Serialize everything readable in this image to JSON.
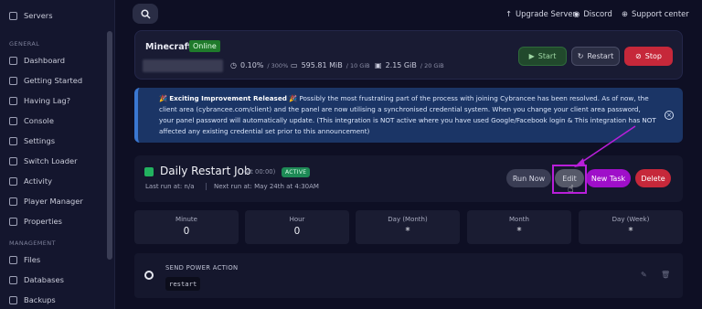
{
  "sidebar": {
    "top_item": "Servers",
    "section_general": "GENERAL",
    "section_management": "MANAGEMENT",
    "items": [
      {
        "label": "Dashboard",
        "icon": "dashboard-icon"
      },
      {
        "label": "Getting Started",
        "icon": "bulb-icon"
      },
      {
        "label": "Having Lag?",
        "icon": "bolt-icon"
      },
      {
        "label": "Console",
        "icon": "terminal-icon"
      },
      {
        "label": "Settings",
        "icon": "gear-icon"
      },
      {
        "label": "Switch Loader",
        "icon": "switch-icon"
      },
      {
        "label": "Activity",
        "icon": "activity-icon"
      },
      {
        "label": "Player Manager",
        "icon": "user-icon"
      },
      {
        "label": "Properties",
        "icon": "file-icon"
      },
      {
        "label": "Files",
        "icon": "folder-icon"
      },
      {
        "label": "Databases",
        "icon": "database-icon"
      },
      {
        "label": "Backups",
        "icon": "archive-icon"
      }
    ]
  },
  "topbar": {
    "upgrade": "Upgrade Server",
    "discord": "Discord",
    "support": "Support center"
  },
  "server": {
    "name": "Minecraft",
    "status": "Online",
    "cpu": "0.10%",
    "cpu_max": "/ 300%",
    "memory": "595.81 MiB",
    "memory_max": "/ 10 GiB",
    "disk": "2.15 GiB",
    "disk_max": "/ 20 GiB",
    "start": "Start",
    "restart": "Restart",
    "stop": "Stop"
  },
  "alert": {
    "title": "Exciting Improvement Released",
    "body": "Possibly the most frustrating part of the process with joining Cybrancee has been resolved. As of now, the client area (cybrancee.com/client) and the panel are now utilising a synchronised credential system. When you change your client area password, your panel password will automatically update. (This integration is NOT active where you have used Google/Facebook login & This integration has NOT affected any existing credential set prior to this announcement)"
  },
  "schedule": {
    "title": "Daily Restart Job",
    "at": "(At 00:00)",
    "badge": "ACTIVE",
    "last_run": "Last run at: n/a",
    "next_run": "Next run at: May 24th at 4:30AM",
    "run_now": "Run Now",
    "edit": "Edit",
    "new_task": "New Task",
    "delete": "Delete",
    "cron": [
      {
        "label": "Minute",
        "value": "0"
      },
      {
        "label": "Hour",
        "value": "0"
      },
      {
        "label": "Day (Month)",
        "value": "*"
      },
      {
        "label": "Month",
        "value": "*"
      },
      {
        "label": "Day (Week)",
        "value": "*"
      }
    ]
  },
  "task": {
    "title": "SEND POWER ACTION",
    "value": "restart"
  },
  "colors": {
    "accent": "#9f0fc9",
    "danger": "#c6283a",
    "online": "#1f7a2b"
  }
}
